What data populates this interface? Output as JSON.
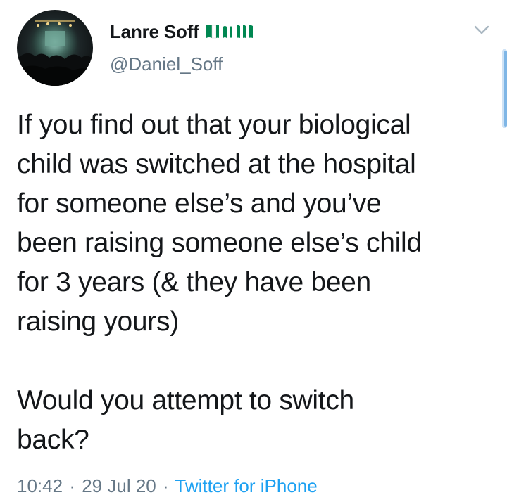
{
  "tweet": {
    "author": {
      "display_name": "Lanre Soff",
      "flag_emoji": "nigeria-flag-icons",
      "handle": "@Daniel_Soff"
    },
    "text": "If you find out that your biological\nchild was switched at the hospital\nfor someone else’s and you’ve\nbeen raising someone else’s child\nfor 3 years (& they have been\nraising yours)\n\nWould you attempt to switch\nback?",
    "time": "10:42",
    "date": "29 Jul 20",
    "separator": "·",
    "source": "Twitter for iPhone"
  },
  "colors": {
    "text": "#14171a",
    "secondary": "#657786",
    "link": "#1da1f2",
    "flag_green": "#008751",
    "scrollbar": "#7fb6e6"
  },
  "icons": {
    "more_menu": "chevron-down-icon",
    "avatar": "avatar-photo"
  }
}
